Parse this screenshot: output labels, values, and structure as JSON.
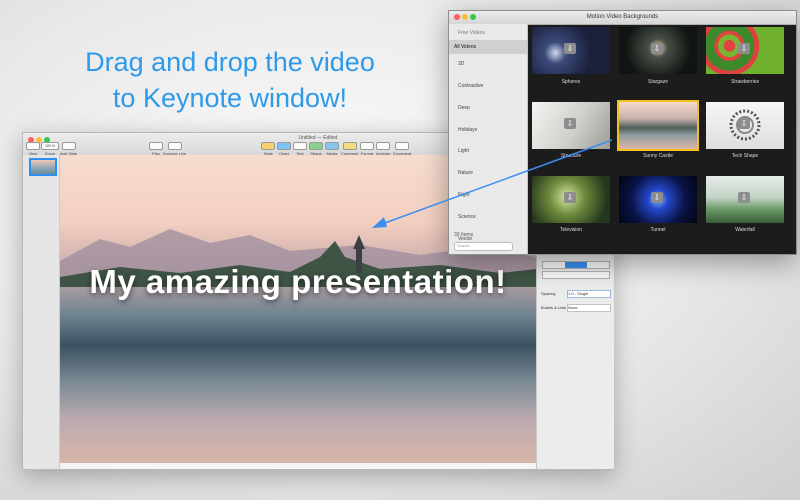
{
  "headline": {
    "line1": "Drag and drop the video",
    "line2": "to Keynote window!"
  },
  "keynote": {
    "title": "Untitled — Edited",
    "toolbar": {
      "left": [
        "View",
        "Zoom",
        "Add Slide"
      ],
      "zoom_value": "100 %",
      "center": [
        "Play",
        "Keynote Live"
      ],
      "right": [
        "Table",
        "Chart",
        "Text",
        "Shape",
        "Media",
        "Comment",
        "Format",
        "Animate",
        "Document"
      ]
    },
    "slide_text": "My amazing presentation!",
    "inspector": {
      "spacing_label": "Spacing",
      "spacing_value": "1.0 - Single",
      "bullets_label": "Bullets & Lists",
      "bullets_value": "None"
    }
  },
  "mvb": {
    "title": "Motion Video Backgrounds",
    "header": "Free Videos",
    "categories": [
      "All Videos",
      "3D",
      "Contrastive",
      "Deep",
      "Holidays",
      "Light",
      "Nature",
      "Night",
      "Science",
      "Vector"
    ],
    "active_category": "All Videos",
    "item_count": "30 Items",
    "search_placeholder": "Search",
    "videos": [
      "Spheres",
      "Stargaze",
      "Strawberries",
      "Structure",
      "Sunny Castle",
      "Tech Shape",
      "Television",
      "Tunnel",
      "Waterfall"
    ],
    "selected_video": "Sunny Castle"
  },
  "colors": {
    "accent": "#2e9ae8",
    "selection": "#f3c220",
    "keynote_selection": "#3a8ef2"
  }
}
